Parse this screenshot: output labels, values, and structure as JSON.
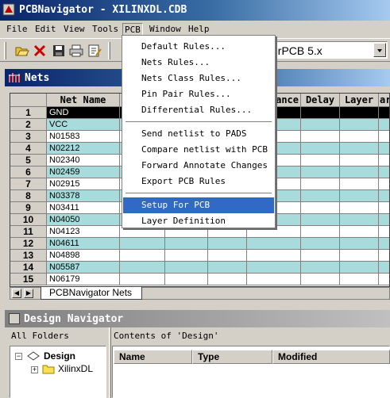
{
  "window": {
    "title": "PCBNavigator - XILINXDL.CDB"
  },
  "menubar": [
    "File",
    "Edit",
    "View",
    "Tools",
    "PCB",
    "Window",
    "Help"
  ],
  "toolbar": {
    "buttons": [
      "open-folder-icon",
      "delete-icon",
      "save-icon",
      "print-icon",
      "edit-icon"
    ],
    "combo_value": "erPCB 5.x"
  },
  "nets_pane": {
    "title": "Nets",
    "columns": [
      "",
      "Net Name",
      "",
      "",
      "",
      "ance",
      "Delay",
      "Layer",
      "ar"
    ],
    "rows": [
      {
        "num": "1",
        "name": "GND",
        "selected": true
      },
      {
        "num": "2",
        "name": "VCC"
      },
      {
        "num": "3",
        "name": "N01583"
      },
      {
        "num": "4",
        "name": "N02212"
      },
      {
        "num": "5",
        "name": "N02340"
      },
      {
        "num": "6",
        "name": "N02459"
      },
      {
        "num": "7",
        "name": "N02915"
      },
      {
        "num": "8",
        "name": "N03378"
      },
      {
        "num": "9",
        "name": "N03411"
      },
      {
        "num": "10",
        "name": "N04050"
      },
      {
        "num": "11",
        "name": "N04123"
      },
      {
        "num": "12",
        "name": "N04611"
      },
      {
        "num": "13",
        "name": "N04898"
      },
      {
        "num": "14",
        "name": "N05587"
      },
      {
        "num": "15",
        "name": "N06179"
      }
    ],
    "sheet_tab": "PCBNavigator Nets"
  },
  "design_navigator": {
    "title": "Design Navigator",
    "all_folders": "All Folders",
    "contents_label": "Contents of 'Design'",
    "tree": [
      {
        "label": "Design",
        "expanded": true
      },
      {
        "label": "XilinxDL",
        "expanded": false
      }
    ],
    "columns": [
      "Name",
      "Type",
      "Modified"
    ]
  },
  "pcb_menu": {
    "items": [
      "Default Rules...",
      "Nets Rules...",
      "Nets Class Rules...",
      "Pin Pair Rules...",
      "Differential Rules...",
      "Send netlist to PADS",
      "Compare netlist with PCB",
      "Forward Annotate Changes",
      "Export PCB Rules",
      "Setup For PCB",
      "Layer Definition"
    ],
    "highlighted": "Setup For PCB"
  }
}
